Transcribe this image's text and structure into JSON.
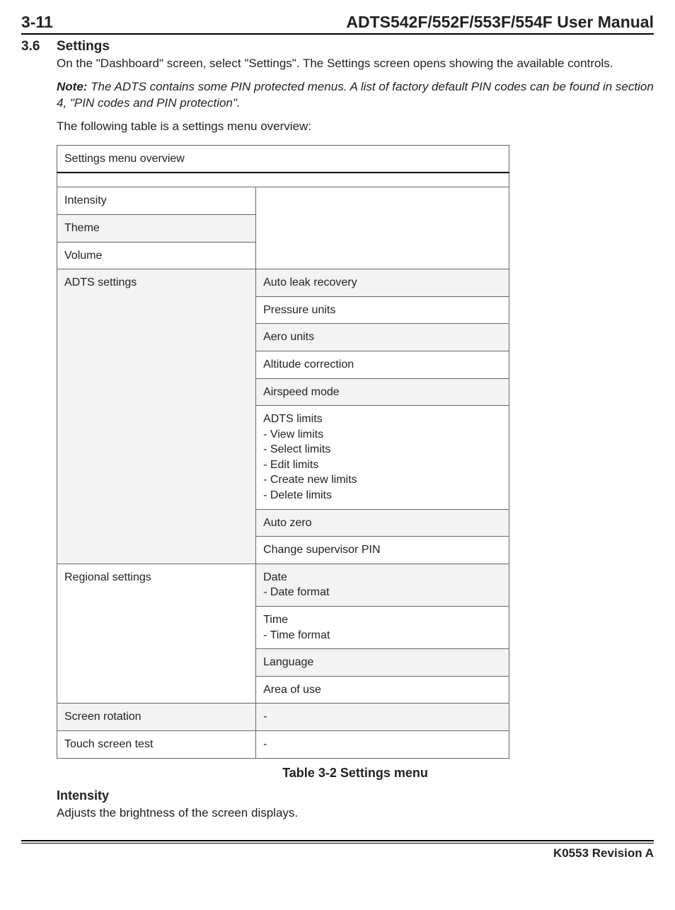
{
  "header": {
    "page_ref": "3-11",
    "manual_title": "ADTS542F/552F/553F/554F User Manual"
  },
  "section": {
    "number": "3.6",
    "title": "Settings",
    "intro": "On the \"Dashboard\" screen, select \"Settings\". The Settings screen opens showing the available controls.",
    "note_label": "Note:",
    "note_body": " The ADTS contains some PIN protected menus. A list of factory default PIN codes can be found in section 4, \"PIN codes and PIN protection\".",
    "lead_in": "The following table is a settings menu overview:"
  },
  "table": {
    "header": "Settings menu overview",
    "rows": {
      "r1": "Intensity",
      "r2": "Theme",
      "r3": "Volume",
      "adts_label": "ADTS settings",
      "adts": {
        "a1": "Auto leak recovery",
        "a2": "Pressure units",
        "a3": "Aero units",
        "a4": "Altitude correction",
        "a5": "Airspeed mode",
        "a6_l1": "ADTS limits",
        "a6_l2": "- View limits",
        "a6_l3": "- Select limits",
        "a6_l4": "- Edit limits",
        "a6_l5": "- Create new limits",
        "a6_l6": "- Delete limits",
        "a7": "Auto zero",
        "a8": "Change supervisor PIN"
      },
      "regional_label": "Regional settings",
      "regional": {
        "r1_l1": "Date",
        "r1_l2": "- Date format",
        "r2_l1": "Time",
        "r2_l2": "- Time format",
        "r3": "Language",
        "r4": "Area of use"
      },
      "screen_rot_label": "Screen rotation",
      "screen_rot_val": "-",
      "touch_label": "Touch screen test",
      "touch_val": "-"
    },
    "caption": "Table 3-2 Settings menu"
  },
  "intensity": {
    "heading": "Intensity",
    "text": "Adjusts the brightness of the screen displays."
  },
  "footer": {
    "revision": "K0553 Revision A"
  }
}
